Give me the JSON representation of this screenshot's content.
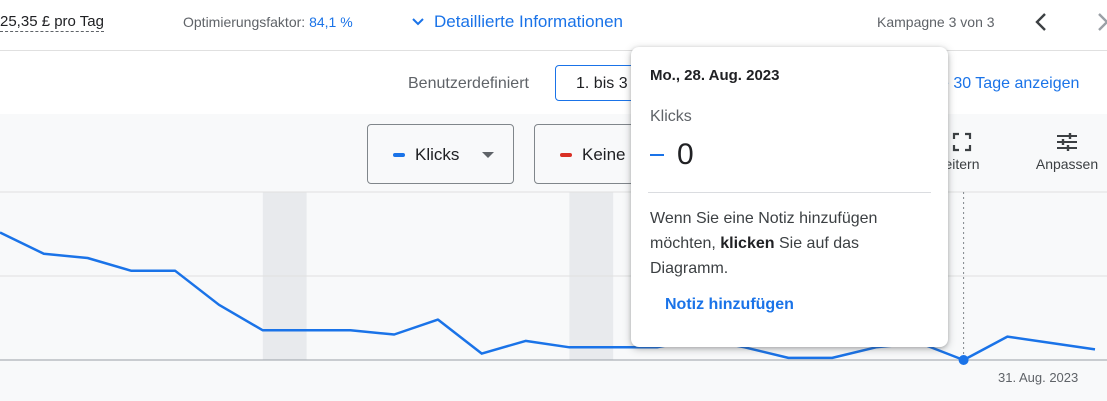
{
  "topbar": {
    "budget": "25,35 £ pro Tag",
    "optimization_label": "Optimierungsfaktor:",
    "optimization_value": "84,1 %",
    "details_link": "Detaillierte Informationen",
    "campaign_counter": "Kampagne 3 von 3"
  },
  "daterow": {
    "preset_label": "Benutzerdefiniert",
    "range_value": "1. bis 3",
    "show_30_days": "e 30 Tage anzeigen"
  },
  "chart_toolbar": {
    "metric1": "Klicks",
    "metric2": "Keine ",
    "expand_label": "eitern",
    "customize_label": "Anpassen"
  },
  "colors": {
    "metric1": "#1a73e8",
    "metric2": "#d93025",
    "accent": "#1a73e8"
  },
  "chart_data": {
    "type": "line",
    "series": [
      {
        "values": [
          6.0,
          5.0,
          4.8,
          4.2,
          4.2,
          2.6,
          1.4,
          1.4,
          1.4,
          1.2,
          1.9,
          0.3,
          0.9,
          0.6,
          0.6,
          0.6,
          1.0,
          0.6,
          0.1,
          0.1,
          0.6,
          0.8,
          0.0,
          1.1,
          0.8,
          0.5
        ]
      }
    ],
    "x_end_label": "31. Aug. 2023",
    "highlight_index": 22,
    "weekend_bands": [
      [
        6,
        7
      ],
      [
        13,
        14
      ]
    ]
  },
  "tooltip": {
    "date": "Mo., 28. Aug. 2023",
    "metric": "Klicks",
    "value": "0",
    "note_part1": "Wenn Sie eine Notiz hinzufügen möchten, ",
    "note_bold": "klicken",
    "note_part2": " Sie auf das Diagramm.",
    "add_note": "Notiz hinzufügen"
  }
}
